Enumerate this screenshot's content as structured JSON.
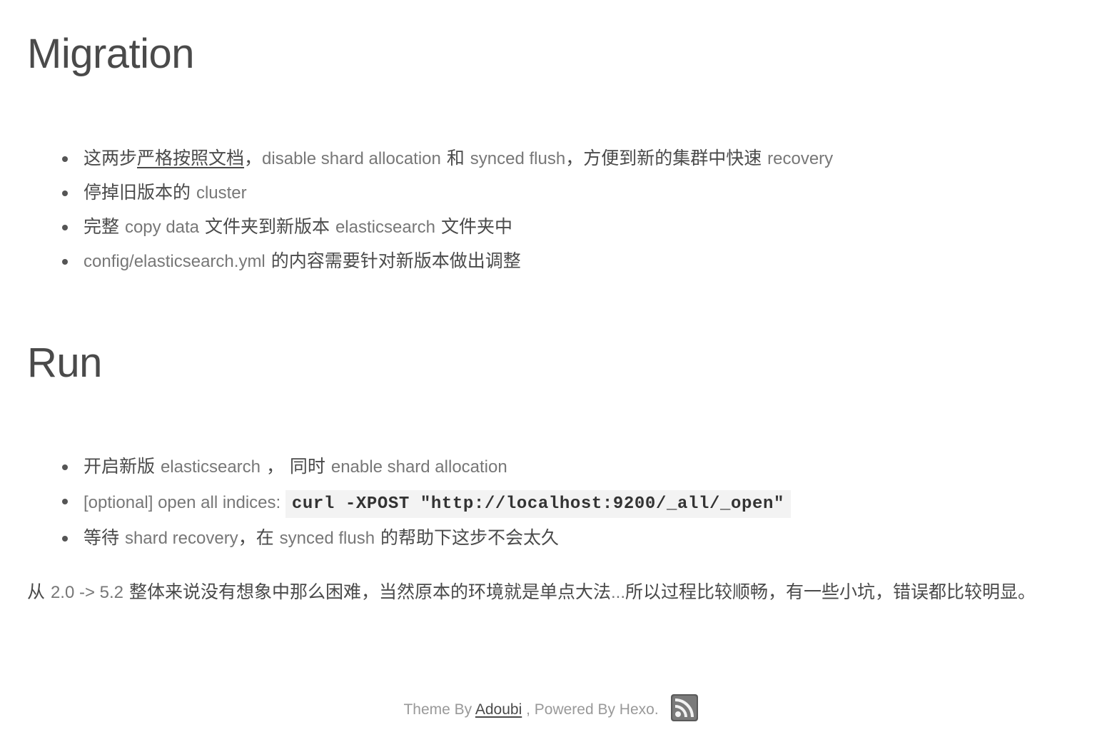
{
  "sections": [
    {
      "title": "Migration",
      "items": [
        [
          {
            "t": "这两步",
            "k": "cjk"
          },
          {
            "t": "严格按照文档",
            "k": "link"
          },
          {
            "t": "，",
            "k": "cjk"
          },
          {
            "t": "disable shard allocation",
            "k": "lat"
          },
          {
            "t": " 和 ",
            "k": "cjk"
          },
          {
            "t": "synced flush",
            "k": "lat"
          },
          {
            "t": "，方便到新的集群中快速 ",
            "k": "cjk"
          },
          {
            "t": "recovery",
            "k": "lat"
          }
        ],
        [
          {
            "t": "停掉旧版本的 ",
            "k": "cjk"
          },
          {
            "t": "cluster",
            "k": "lat"
          }
        ],
        [
          {
            "t": "完整 ",
            "k": "cjk"
          },
          {
            "t": "copy data",
            "k": "lat"
          },
          {
            "t": " 文件夹到新版本 ",
            "k": "cjk"
          },
          {
            "t": "elasticsearch",
            "k": "lat"
          },
          {
            "t": " 文件夹中",
            "k": "cjk"
          }
        ],
        [
          {
            "t": "config/elasticsearch.yml",
            "k": "lat"
          },
          {
            "t": " 的内容需要针对新版本做出调整",
            "k": "cjk"
          }
        ]
      ]
    },
    {
      "title": "Run",
      "items": [
        [
          {
            "t": "开启新版 ",
            "k": "cjk"
          },
          {
            "t": "elasticsearch",
            "k": "lat"
          },
          {
            "t": " ， 同时 ",
            "k": "cjk"
          },
          {
            "t": "enable shard allocation",
            "k": "lat"
          }
        ],
        [
          {
            "t": "[optional] open all indices: ",
            "k": "lat"
          },
          {
            "t": "curl -XPOST \"http://localhost:9200/_all/_open\"",
            "k": "code"
          }
        ],
        [
          {
            "t": "等待 ",
            "k": "cjk"
          },
          {
            "t": "shard recovery",
            "k": "lat"
          },
          {
            "t": "，在 ",
            "k": "cjk"
          },
          {
            "t": "synced flush",
            "k": "lat"
          },
          {
            "t": " 的帮助下这步不会太久",
            "k": "cjk"
          }
        ]
      ]
    }
  ],
  "summary": [
    {
      "t": "从 ",
      "k": "cjk"
    },
    {
      "t": "2.0 -> 5.2",
      "k": "lat"
    },
    {
      "t": " 整体来说没有想象中那么困难，当然原本的环境就是单点大法",
      "k": "cjk"
    },
    {
      "t": "...",
      "k": "lat"
    },
    {
      "t": "所以过程比较顺畅，有一些小坑，错误都比较明显。",
      "k": "cjk"
    }
  ],
  "footer": {
    "prefix": "Theme By ",
    "author_link": "Adoubi",
    "suffix": " , Powered By Hexo.",
    "rss_icon": "rss-icon"
  }
}
